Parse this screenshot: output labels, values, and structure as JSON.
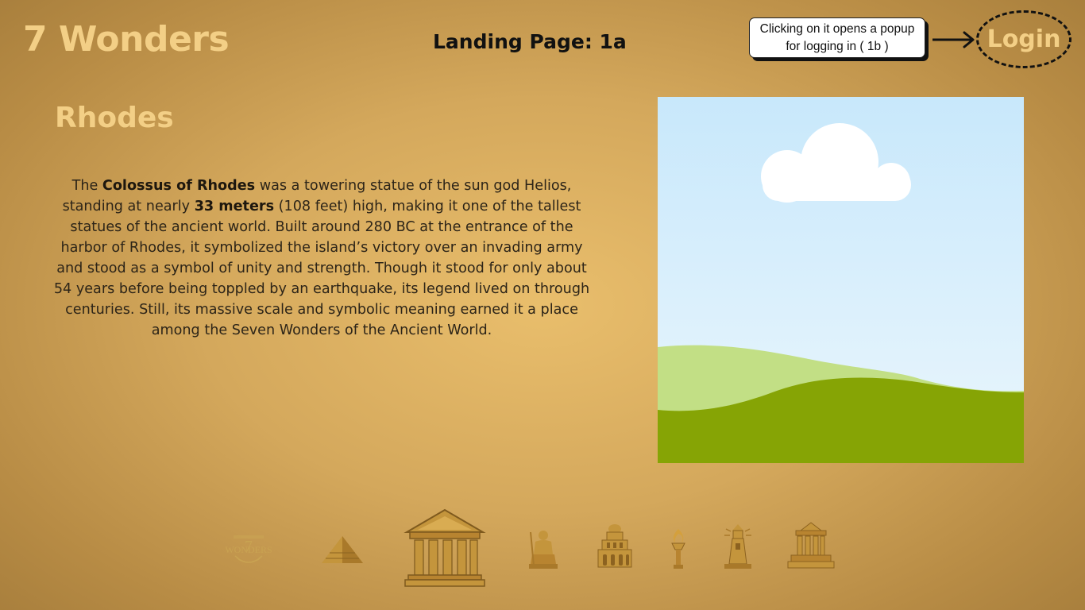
{
  "header": {
    "brand": "7 Wonders",
    "page_label": "Landing Page: 1a",
    "login_note": "Clicking on it opens a popup for logging in ( 1b )",
    "login_label": "Login"
  },
  "main": {
    "title": "Rhodes",
    "description": {
      "p1": "The ",
      "b1": "Colossus of Rhodes",
      "p2": " was a towering statue of the sun god Helios, standing at nearly ",
      "b2": "33 meters",
      "p3": " (108 feet) high, making it one of the tallest statues of the ancient world. Built around 280 BC at the entrance of the harbor of Rhodes, it symbolized the island’s victory over an invading army and stood as a symbol of unity and strength. Though it stood for only about 54 years before being toppled by an earthquake, its legend lived on through centuries. Still, its massive scale and symbolic meaning earned it a place among the Seven Wonders of the Ancient World."
    },
    "image": {
      "type": "placeholder-landscape",
      "sky_top": "#c8e8fb",
      "sky_bottom": "#eaf6fd",
      "hill_light": "#c2df85",
      "hill_dark": "#86a405",
      "cloud": "#ffffff"
    }
  },
  "nav_icons": {
    "logo_text": "WONDERS",
    "logo_numeral": "7",
    "items": [
      "7-wonders-logo-icon",
      "pyramid-icon",
      "temple-icon",
      "zeus-statue-icon",
      "hanging-gardens-icon",
      "torch-icon",
      "lighthouse-icon",
      "mausoleum-icon"
    ]
  },
  "colors": {
    "accent": "#f3cf86",
    "icon_gold": "#c4953c",
    "background_center": "#e9be6c",
    "background_edge": "#a77e3c"
  }
}
